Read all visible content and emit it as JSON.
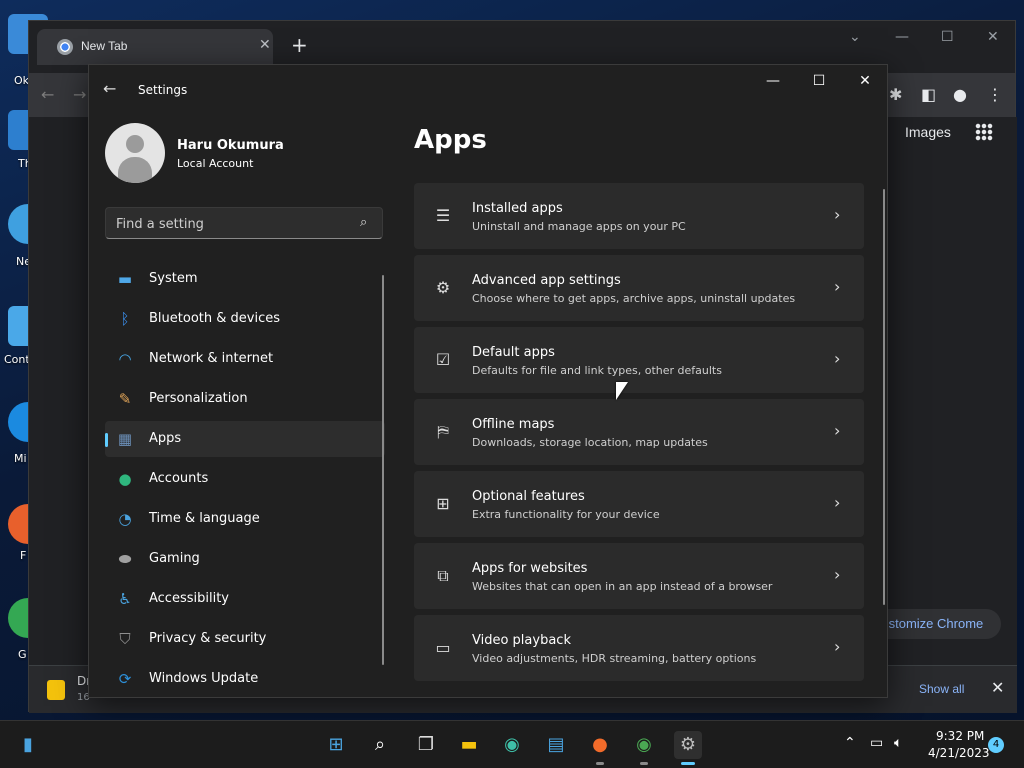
{
  "desktop": {
    "labels": [
      "Ok",
      "Th",
      "Ne",
      "Cont",
      "Mi",
      "F",
      "G"
    ]
  },
  "chrome": {
    "tab_title": "New Tab",
    "images_link": "Images",
    "customize_label": "ıstomize Chrome",
    "download_name": "Dr",
    "download_sub": "16",
    "show_all": "Show all"
  },
  "settings": {
    "window_title": "Settings",
    "user": {
      "name": "Haru Okumura",
      "account_type": "Local Account"
    },
    "search": {
      "placeholder": "Find a setting"
    },
    "nav": [
      {
        "label": "System",
        "icon": "monitor-icon",
        "color": "#4fa8e8"
      },
      {
        "label": "Bluetooth & devices",
        "icon": "bluetooth-icon",
        "color": "#3b8eea"
      },
      {
        "label": "Network & internet",
        "icon": "wifi-icon",
        "color": "#47a6e6"
      },
      {
        "label": "Personalization",
        "icon": "brush-icon",
        "color": "#e0a458"
      },
      {
        "label": "Apps",
        "icon": "apps-icon",
        "color": "#6b8fb8",
        "active": true
      },
      {
        "label": "Accounts",
        "icon": "person-icon",
        "color": "#2fb67e"
      },
      {
        "label": "Time & language",
        "icon": "globe-clock-icon",
        "color": "#4aa3df"
      },
      {
        "label": "Gaming",
        "icon": "gamepad-icon",
        "color": "#a0a0a0"
      },
      {
        "label": "Accessibility",
        "icon": "accessibility-icon",
        "color": "#4aa3df"
      },
      {
        "label": "Privacy & security",
        "icon": "shield-icon",
        "color": "#8f8f8f"
      },
      {
        "label": "Windows Update",
        "icon": "update-icon",
        "color": "#2d8fd8"
      }
    ],
    "page_title": "Apps",
    "cards": [
      {
        "title": "Installed apps",
        "subtitle": "Uninstall and manage apps on your PC",
        "icon": "list-icon"
      },
      {
        "title": "Advanced app settings",
        "subtitle": "Choose where to get apps, archive apps, uninstall updates",
        "icon": "app-settings-icon"
      },
      {
        "title": "Default apps",
        "subtitle": "Defaults for file and link types, other defaults",
        "icon": "default-apps-icon"
      },
      {
        "title": "Offline maps",
        "subtitle": "Downloads, storage location, map updates",
        "icon": "map-icon"
      },
      {
        "title": "Optional features",
        "subtitle": "Extra functionality for your device",
        "icon": "optional-features-icon"
      },
      {
        "title": "Apps for websites",
        "subtitle": "Websites that can open in an app instead of a browser",
        "icon": "open-external-icon"
      },
      {
        "title": "Video playback",
        "subtitle": "Video adjustments, HDR streaming, battery options",
        "icon": "video-icon"
      }
    ]
  },
  "taskbar": {
    "time": "9:32 PM",
    "date": "4/21/2023",
    "notification_count": "4",
    "accent": "#60cdff"
  }
}
